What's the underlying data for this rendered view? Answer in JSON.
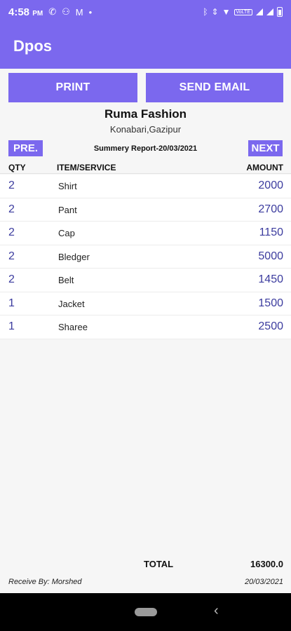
{
  "status_bar": {
    "time": "4:58",
    "time_suffix": "PM",
    "network_badge": "VoLTE"
  },
  "app_bar": {
    "title": "Dpos"
  },
  "actions": {
    "print_label": "PRINT",
    "email_label": "SEND EMAIL"
  },
  "shop": {
    "name": "Ruma Fashion",
    "address": "Konabari,Gazipur"
  },
  "report": {
    "prev_label": "PRE.",
    "next_label": "NEXT",
    "title": "Summery Report-20/03/2021"
  },
  "table": {
    "headers": {
      "qty": "QTY",
      "item": "ITEM/SERVICE",
      "amount": "AMOUNT"
    },
    "rows": [
      {
        "qty": "2",
        "item": "Shirt",
        "amount": "2000"
      },
      {
        "qty": "2",
        "item": "Pant",
        "amount": "2700"
      },
      {
        "qty": "2",
        "item": "Cap",
        "amount": "1150"
      },
      {
        "qty": "2",
        "item": "Bledger",
        "amount": "5000"
      },
      {
        "qty": "2",
        "item": "Belt",
        "amount": "1450"
      },
      {
        "qty": "1",
        "item": "Jacket",
        "amount": "1500"
      },
      {
        "qty": "1",
        "item": "Sharee",
        "amount": "2500"
      }
    ]
  },
  "footer": {
    "total_label": "TOTAL",
    "total_value": "16300.0",
    "received_by": "Receive By: Morshed",
    "date": "20/03/2021"
  },
  "colors": {
    "accent": "#7b68ee",
    "amount_text": "#3b3b9e"
  }
}
